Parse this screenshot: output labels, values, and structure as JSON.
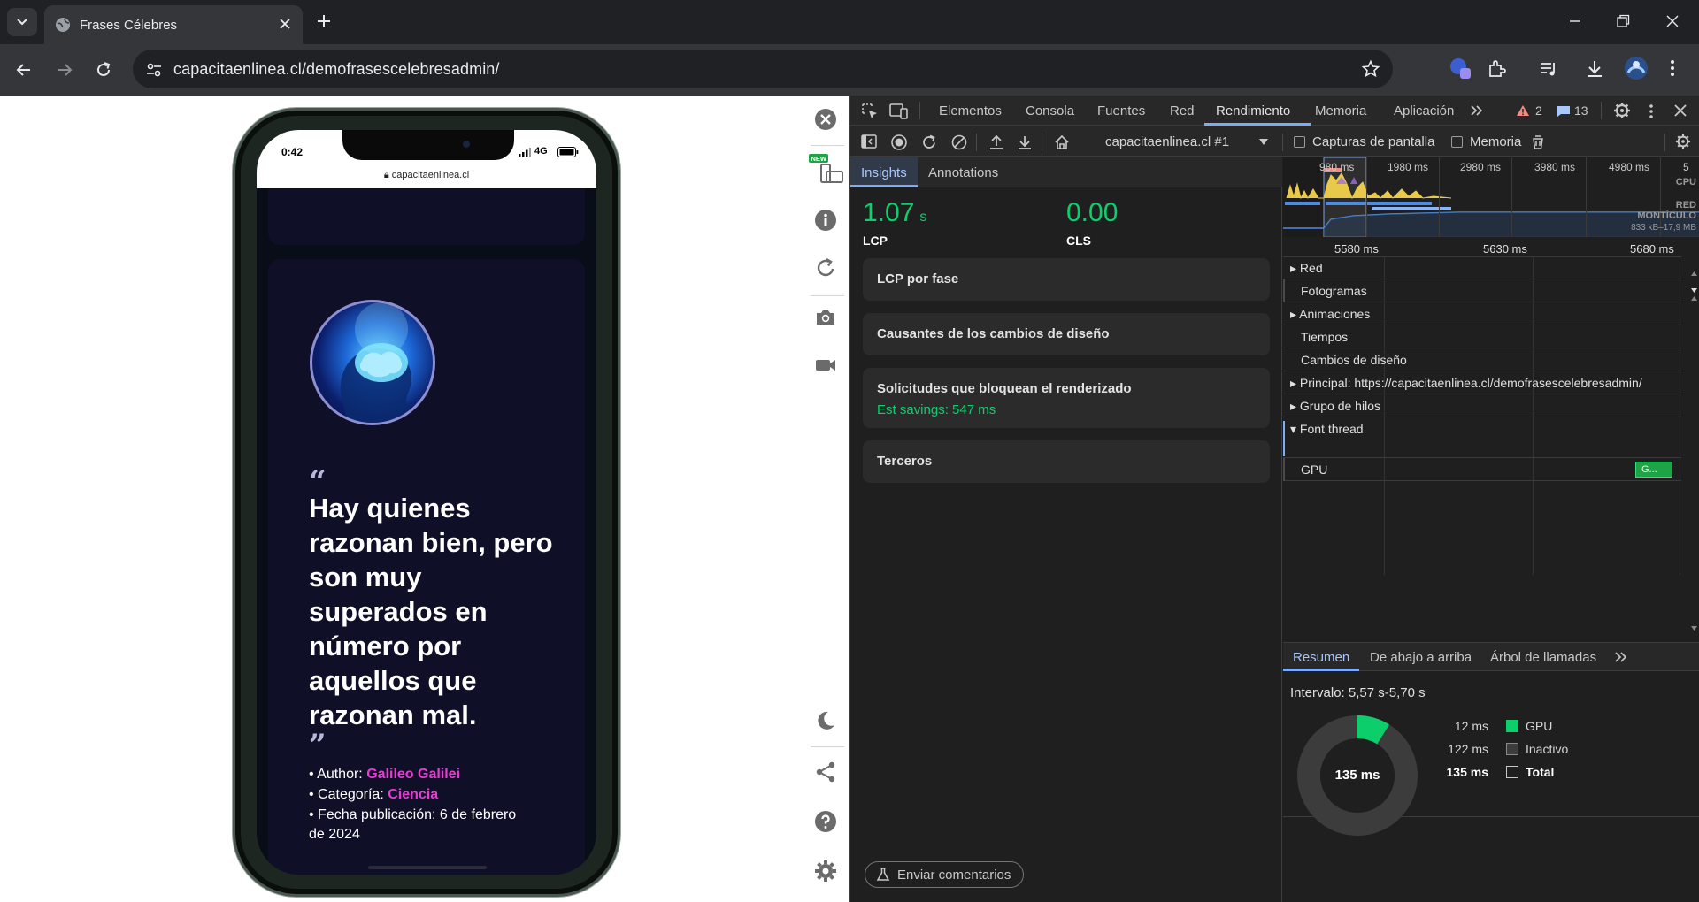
{
  "browser": {
    "tab_title": "Frases Célebres",
    "url": "capacitaenlinea.cl/demofrasescelebresadmin/"
  },
  "phone": {
    "time": "0:42",
    "network": "4G",
    "address": "capacitaenlinea.cl",
    "quote": "Hay quienes razonan bien, pero son muy superados en número por aquellos que razonan mal.",
    "open_mark": "“",
    "close_mark": "”",
    "author_label": "• Author: ",
    "author": "Galileo Galilei",
    "category_label": "• Categoría: ",
    "category": "Ciencia",
    "date_line_1": "• Fecha publicación: 6 de febrero",
    "date_line_2": "de 2024"
  },
  "emulator_sidebar": {
    "new_badge": "NEW"
  },
  "devtools": {
    "tabs": [
      "Elementos",
      "Consola",
      "Fuentes",
      "Red",
      "Rendimiento",
      "Memoria",
      "Aplicación"
    ],
    "active_tab": "Rendimiento",
    "warnings": "2",
    "messages": "13",
    "toolbar": {
      "recording": "capacitaenlinea.cl #1",
      "screenshots_label": "Capturas de pantalla",
      "memory_label": "Memoria"
    },
    "insights": {
      "tabs": [
        "Insights",
        "Annotations"
      ],
      "lcp_value": "1.07",
      "lcp_unit": "s",
      "lcp_label": "LCP",
      "cls_value": "0.00",
      "cls_label": "CLS",
      "cards": [
        {
          "title": "LCP por fase"
        },
        {
          "title": "Causantes de los cambios de diseño"
        },
        {
          "title": "Solicitudes que bloquean el renderizado",
          "subtitle": "Est savings: 547 ms"
        },
        {
          "title": "Terceros"
        }
      ],
      "feedback": "Enviar comentarios"
    },
    "overview": {
      "ticks": [
        "980 ms",
        "1980 ms",
        "2980 ms",
        "3980 ms",
        "4980 ms",
        "5"
      ],
      "cpu_label": "CPU",
      "net_label": "RED",
      "heap_label": "MONTÍCULO",
      "heap_range": "833 kB–17,9 MB"
    },
    "ruler": [
      "5580 ms",
      "5630 ms",
      "5680 ms"
    ],
    "tracks": [
      {
        "label": "Red",
        "expandable": true
      },
      {
        "label": "Fotogramas",
        "expandable": false
      },
      {
        "label": "Animaciones",
        "expandable": true
      },
      {
        "label": "Tiempos",
        "expandable": false
      },
      {
        "label": "Cambios de diseño",
        "expandable": false
      },
      {
        "label": "Principal: https://capacitaenlinea.cl/demofrasescelebresadmin/",
        "expandable": true
      },
      {
        "label": "Grupo de hilos",
        "expandable": true
      },
      {
        "label": "Font thread",
        "expandable": true,
        "expanded": true
      },
      {
        "label": "GPU",
        "expandable": false
      }
    ],
    "gpu_event": "G...",
    "summary": {
      "tabs": [
        "Resumen",
        "De abajo a arriba",
        "Árbol de llamadas"
      ],
      "range": "Intervalo: 5,57 s-5,70 s",
      "total_center": "135 ms",
      "rows": [
        {
          "value": "12 ms",
          "label": "GPU",
          "color": "#0cce6b"
        },
        {
          "value": "122 ms",
          "label": "Inactivo",
          "color": "#3c3c3c"
        },
        {
          "value": "135 ms",
          "label": "Total",
          "color": "transparent"
        }
      ]
    }
  }
}
